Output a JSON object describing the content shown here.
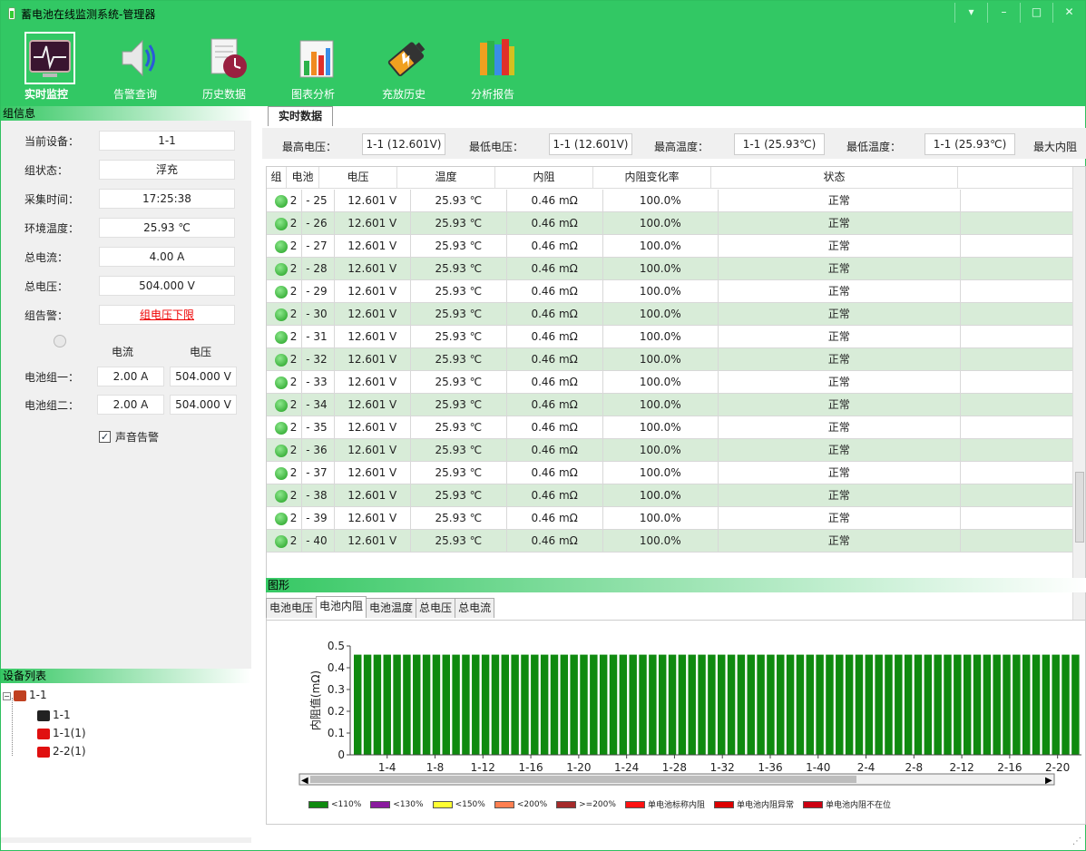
{
  "window": {
    "title": "蓄电池在线监测系统-管理器",
    "controls": [
      "▾",
      "–",
      "□",
      "✕"
    ]
  },
  "toolbar": [
    {
      "label": "实时监控",
      "icon": "monitor-icon",
      "active": true
    },
    {
      "label": "告警查询",
      "icon": "speaker-icon"
    },
    {
      "label": "历史数据",
      "icon": "history-doc-icon"
    },
    {
      "label": "图表分析",
      "icon": "chart-icon"
    },
    {
      "label": "充放历史",
      "icon": "battery-icon"
    },
    {
      "label": "分析报告",
      "icon": "books-icon"
    }
  ],
  "group_info": {
    "header": "组信息",
    "rows": [
      {
        "label": "当前设备：",
        "value": "1-1"
      },
      {
        "label": "组状态：",
        "value": "浮充"
      },
      {
        "label": "采集时间：",
        "value": "17:25:38"
      },
      {
        "label": "环境温度：",
        "value": "25.93 ℃"
      },
      {
        "label": "总电流：",
        "value": "4.00 A"
      },
      {
        "label": "总电压：",
        "value": "504.000 V"
      },
      {
        "label": "组告警：",
        "value": "组电压下限"
      }
    ],
    "col_current": "电流",
    "col_voltage": "电压",
    "groups": [
      {
        "label": "电池组一：",
        "current": "2.00 A",
        "voltage": "504.000 V"
      },
      {
        "label": "电池组二：",
        "current": "2.00 A",
        "voltage": "504.000 V"
      }
    ],
    "sound_alarm": "声音告警",
    "sound_alarm_checked": true
  },
  "device_list": {
    "header": "设备列表",
    "nodes": [
      {
        "label": "1-1",
        "level": 0,
        "type": "station"
      },
      {
        "label": "1-1",
        "level": 1,
        "type": "device-black"
      },
      {
        "label": "1-1(1)",
        "level": 1,
        "type": "device-red"
      },
      {
        "label": "2-2(1)",
        "level": 1,
        "type": "device-red"
      }
    ]
  },
  "realtime": {
    "tab": "实时数据",
    "summary": [
      {
        "label": "最高电压：",
        "value": "1-1 (12.601V)"
      },
      {
        "label": "最低电压：",
        "value": "1-1 (12.601V)"
      },
      {
        "label": "最高温度：",
        "value": "1-1 (25.93℃)"
      },
      {
        "label": "最低温度：",
        "value": "1-1 (25.93℃)"
      },
      {
        "label": "最大内阻",
        "value": ""
      }
    ],
    "columns": [
      "组",
      "电池",
      "电压",
      "温度",
      "内阻",
      "内阻变化率",
      "状态"
    ],
    "rows": [
      {
        "group": "2",
        "cell": "- 25",
        "voltage": "12.601 V",
        "temp": "25.93 ℃",
        "res": "0.46 mΩ",
        "rate": "100.0%",
        "status": "正常"
      },
      {
        "group": "2",
        "cell": "- 26",
        "voltage": "12.601 V",
        "temp": "25.93 ℃",
        "res": "0.46 mΩ",
        "rate": "100.0%",
        "status": "正常"
      },
      {
        "group": "2",
        "cell": "- 27",
        "voltage": "12.601 V",
        "temp": "25.93 ℃",
        "res": "0.46 mΩ",
        "rate": "100.0%",
        "status": "正常"
      },
      {
        "group": "2",
        "cell": "- 28",
        "voltage": "12.601 V",
        "temp": "25.93 ℃",
        "res": "0.46 mΩ",
        "rate": "100.0%",
        "status": "正常"
      },
      {
        "group": "2",
        "cell": "- 29",
        "voltage": "12.601 V",
        "temp": "25.93 ℃",
        "res": "0.46 mΩ",
        "rate": "100.0%",
        "status": "正常"
      },
      {
        "group": "2",
        "cell": "- 30",
        "voltage": "12.601 V",
        "temp": "25.93 ℃",
        "res": "0.46 mΩ",
        "rate": "100.0%",
        "status": "正常"
      },
      {
        "group": "2",
        "cell": "- 31",
        "voltage": "12.601 V",
        "temp": "25.93 ℃",
        "res": "0.46 mΩ",
        "rate": "100.0%",
        "status": "正常"
      },
      {
        "group": "2",
        "cell": "- 32",
        "voltage": "12.601 V",
        "temp": "25.93 ℃",
        "res": "0.46 mΩ",
        "rate": "100.0%",
        "status": "正常"
      },
      {
        "group": "2",
        "cell": "- 33",
        "voltage": "12.601 V",
        "temp": "25.93 ℃",
        "res": "0.46 mΩ",
        "rate": "100.0%",
        "status": "正常"
      },
      {
        "group": "2",
        "cell": "- 34",
        "voltage": "12.601 V",
        "temp": "25.93 ℃",
        "res": "0.46 mΩ",
        "rate": "100.0%",
        "status": "正常"
      },
      {
        "group": "2",
        "cell": "- 35",
        "voltage": "12.601 V",
        "temp": "25.93 ℃",
        "res": "0.46 mΩ",
        "rate": "100.0%",
        "status": "正常"
      },
      {
        "group": "2",
        "cell": "- 36",
        "voltage": "12.601 V",
        "temp": "25.93 ℃",
        "res": "0.46 mΩ",
        "rate": "100.0%",
        "status": "正常"
      },
      {
        "group": "2",
        "cell": "- 37",
        "voltage": "12.601 V",
        "temp": "25.93 ℃",
        "res": "0.46 mΩ",
        "rate": "100.0%",
        "status": "正常"
      },
      {
        "group": "2",
        "cell": "- 38",
        "voltage": "12.601 V",
        "temp": "25.93 ℃",
        "res": "0.46 mΩ",
        "rate": "100.0%",
        "status": "正常"
      },
      {
        "group": "2",
        "cell": "- 39",
        "voltage": "12.601 V",
        "temp": "25.93 ℃",
        "res": "0.46 mΩ",
        "rate": "100.0%",
        "status": "正常"
      },
      {
        "group": "2",
        "cell": "- 40",
        "voltage": "12.601 V",
        "temp": "25.93 ℃",
        "res": "0.46 mΩ",
        "rate": "100.0%",
        "status": "正常"
      }
    ]
  },
  "graphics": {
    "header": "图形",
    "tabs": [
      "电池电压",
      "电池内阻",
      "电池温度",
      "总电压",
      "总电流"
    ],
    "active_tab": 1
  },
  "colors": {
    "accent": "#32c864",
    "row_alt": "#d8ecd8",
    "bar": "#0f8a0f"
  },
  "chart_data": {
    "type": "bar",
    "ylabel": "内阻值(mΩ)",
    "ylim": [
      0,
      0.5
    ],
    "yticks": [
      "0",
      "0.1",
      "0.2",
      "0.3",
      "0.4",
      "0.5"
    ],
    "bar_count": 74,
    "value": 0.46,
    "xtick_labels": [
      "1-4",
      "1-8",
      "1-12",
      "1-16",
      "1-20",
      "1-24",
      "1-28",
      "1-32",
      "1-36",
      "1-40",
      "2-4",
      "2-8",
      "2-12",
      "2-16",
      "2-20"
    ],
    "legend": [
      {
        "label": "<110%",
        "color": "#0f8a0f"
      },
      {
        "label": "<130%",
        "color": "#8a1a9e"
      },
      {
        "label": "<150%",
        "color": "#ffff33"
      },
      {
        "label": "<200%",
        "color": "#ff7f50"
      },
      {
        "label": ">=200%",
        "color": "#a52a2a"
      },
      {
        "label": "单电池标称内阻",
        "color": "#ff1111"
      },
      {
        "label": "单电池内阻异常",
        "color": "#dd0000"
      },
      {
        "label": "单电池内阻不在位",
        "color": "#cc0011"
      }
    ]
  }
}
